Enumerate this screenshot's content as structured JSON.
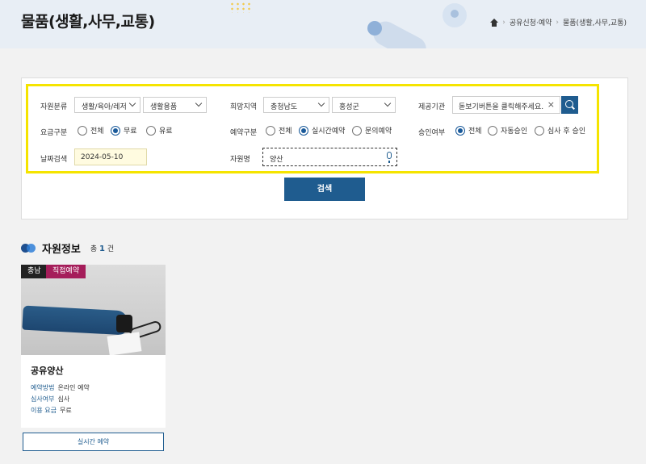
{
  "page": {
    "title": "물품(생활,사무,교통)"
  },
  "breadcrumb": {
    "items": [
      "공유신청·예약",
      "물품(생활,사무,교통)"
    ]
  },
  "filters": {
    "category": {
      "label": "자원분류",
      "first": "생활/육아/레저",
      "second": "생활용품"
    },
    "region": {
      "label": "희망지역",
      "province": "충청남도",
      "county": "홍성군"
    },
    "provider": {
      "label": "제공기관",
      "placeholder": "돋보기버튼을 클릭해주세요."
    },
    "fee": {
      "label": "요금구분",
      "options": [
        "전체",
        "무료",
        "유료"
      ],
      "selected": "무료"
    },
    "booking": {
      "label": "예약구분",
      "options": [
        "전체",
        "실시간예약",
        "문의예약"
      ],
      "selected": "실시간예약"
    },
    "approval": {
      "label": "승인여부",
      "options": [
        "전체",
        "자동승인",
        "심사 후 승인"
      ],
      "selected": "전체"
    },
    "date": {
      "label": "날짜검색",
      "value": "2024-05-10"
    },
    "resource_name": {
      "label": "자원명",
      "value": "양산"
    }
  },
  "search_button": "검색",
  "results": {
    "title": "자원정보",
    "count_prefix": "총",
    "count": "1",
    "count_suffix": "건",
    "items": [
      {
        "region": "충남",
        "type": "직접예약",
        "name": "공유양산",
        "method_label": "예약방법",
        "method": "온라인 예약",
        "review_label": "심사여부",
        "review": "심사",
        "fee_label": "이용 요금",
        "fee": "무료",
        "button": "실시간 예약"
      }
    ]
  },
  "colors": {
    "primary": "#1f5c8f",
    "highlight": "#f5e400",
    "badge_direct": "#a51d5a"
  }
}
